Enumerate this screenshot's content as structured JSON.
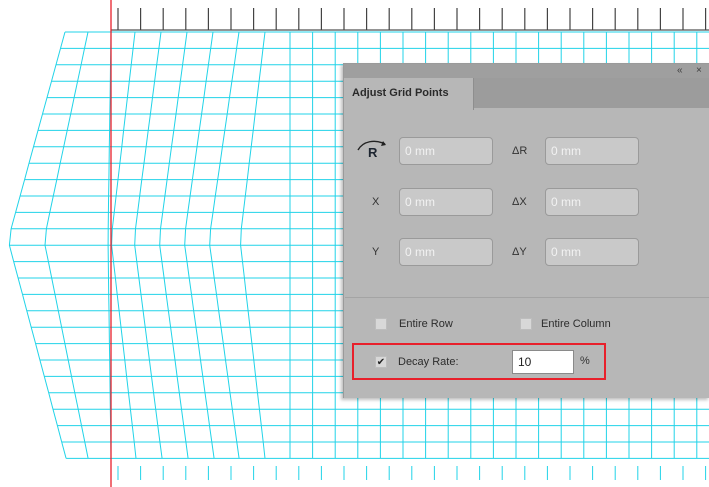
{
  "panel": {
    "title_tab": "Adjust Grid Points",
    "titlebar_buttons": {
      "collapse": "«",
      "close": "×"
    },
    "rotate_icon": "rotate-r-icon",
    "fields": {
      "rotation": {
        "label": "R",
        "value": "0 mm"
      },
      "delta_r": {
        "label": "ΔR",
        "value": "0 mm"
      },
      "x": {
        "label": "X",
        "value": "0 mm"
      },
      "delta_x": {
        "label": "ΔX",
        "value": "0 mm"
      },
      "y": {
        "label": "Y",
        "value": "0 mm"
      },
      "delta_y": {
        "label": "ΔY",
        "value": "0 mm"
      }
    },
    "entire_row": {
      "label": "Entire Row",
      "checked": false
    },
    "entire_column": {
      "label": "Entire Column",
      "checked": false
    },
    "decay_rate": {
      "label": "Decay Rate:",
      "checked": true,
      "value": "10",
      "unit": "%"
    }
  },
  "colors": {
    "grid": "#21d3e8",
    "guide_line": "#e8202b",
    "highlight": "#e8202b",
    "panel_bg": "#b7b7b7"
  }
}
